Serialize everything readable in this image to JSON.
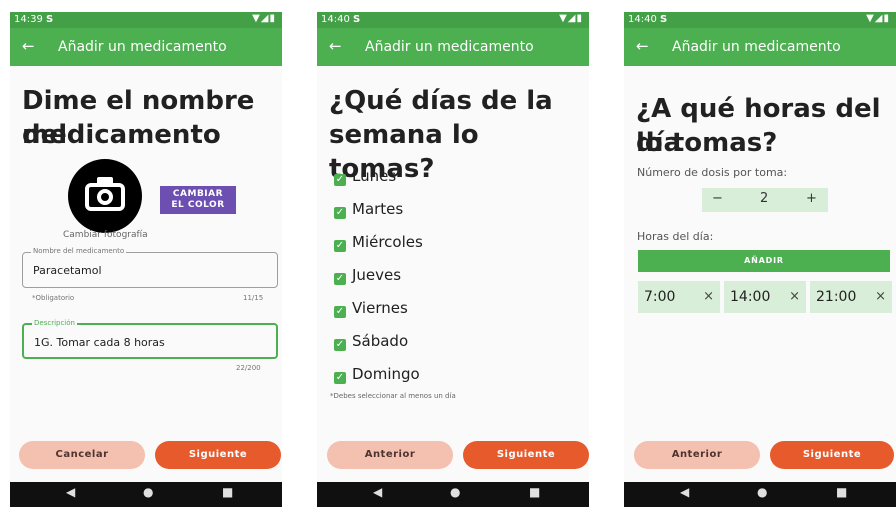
{
  "screens": [
    {
      "status": {
        "time": "14:39",
        "icons": "▼◢▮"
      },
      "appbar": {
        "title": "Añadir un medicamento"
      },
      "heading": [
        "Dime el nombre del",
        "medicamento"
      ],
      "color_button": [
        "CAMBIAR",
        "EL COLOR"
      ],
      "photo_label": "Cambiar fotografía",
      "name_field": {
        "label": "Nombre del medicamento",
        "value": "Paracetamol",
        "helper": "*Obligatorio",
        "counter": "11/15"
      },
      "desc_field": {
        "label": "Descripción",
        "value": "1G. Tomar cada 8 horas",
        "counter": "22/200"
      },
      "buttons": {
        "left": "Cancelar",
        "right": "Siguiente"
      }
    },
    {
      "status": {
        "time": "14:40",
        "icons": "▼◢▮"
      },
      "appbar": {
        "title": "Añadir un medicamento"
      },
      "heading": [
        "¿Qué días de la",
        "semana lo tomas?"
      ],
      "days": [
        "Lunes",
        "Martes",
        "Miércoles",
        "Jueves",
        "Viernes",
        "Sábado",
        "Domingo"
      ],
      "note": "*Debes seleccionar al menos un día",
      "buttons": {
        "left": "Anterior",
        "right": "Siguiente"
      }
    },
    {
      "status": {
        "time": "14:40",
        "icons": "▼◢▮"
      },
      "appbar": {
        "title": "Añadir un medicamento"
      },
      "heading": [
        "¿A qué horas del día",
        "lo tomas?"
      ],
      "doses_label": "Número de dosis por toma:",
      "stepper": {
        "minus": "−",
        "value": "2",
        "plus": "+"
      },
      "hours_label": "Horas del día:",
      "add_button": "AÑADIR",
      "times": [
        "7:00",
        "14:00",
        "21:00"
      ],
      "buttons": {
        "left": "Anterior",
        "right": "Siguiente"
      }
    }
  ],
  "icons": {
    "back": "arrow-left",
    "remove": "×",
    "check": "✓",
    "camera": "camera"
  },
  "colors": {
    "status_bar": "#43a047",
    "app_bar": "#4caf50",
    "primary_btn": "#e65a2c",
    "secondary_btn": "#f4c0b0",
    "accent": "#6c4fb0"
  }
}
